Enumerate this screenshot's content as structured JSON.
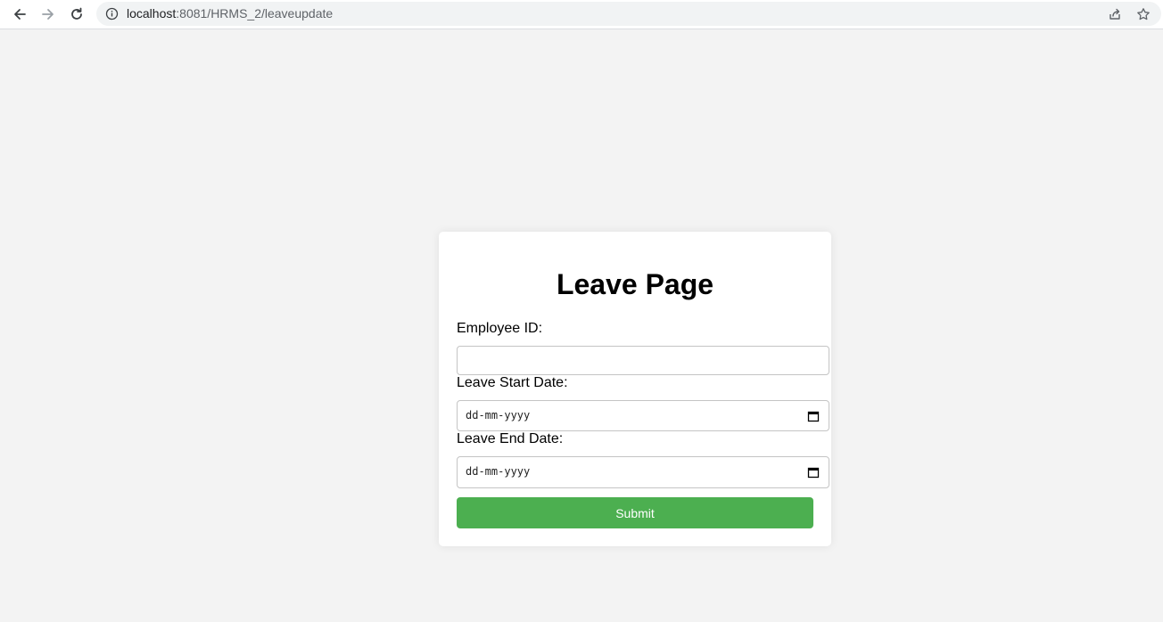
{
  "browser": {
    "url_host": "localhost",
    "url_path": ":8081/HRMS_2/leaveupdate"
  },
  "form": {
    "title": "Leave Page",
    "employee_id_label": "Employee ID:",
    "employee_id_value": "",
    "start_date_label": "Leave Start Date:",
    "start_date_placeholder": "dd-mm-yyyy",
    "end_date_label": "Leave End Date:",
    "end_date_placeholder": "dd-mm-yyyy",
    "submit_label": "Submit"
  },
  "colors": {
    "accent": "#4caf50",
    "background": "#f3f3f3"
  },
  "icons": [
    "back-arrow-icon",
    "forward-arrow-icon",
    "reload-icon",
    "info-icon",
    "share-icon",
    "star-icon",
    "calendar-icon"
  ]
}
